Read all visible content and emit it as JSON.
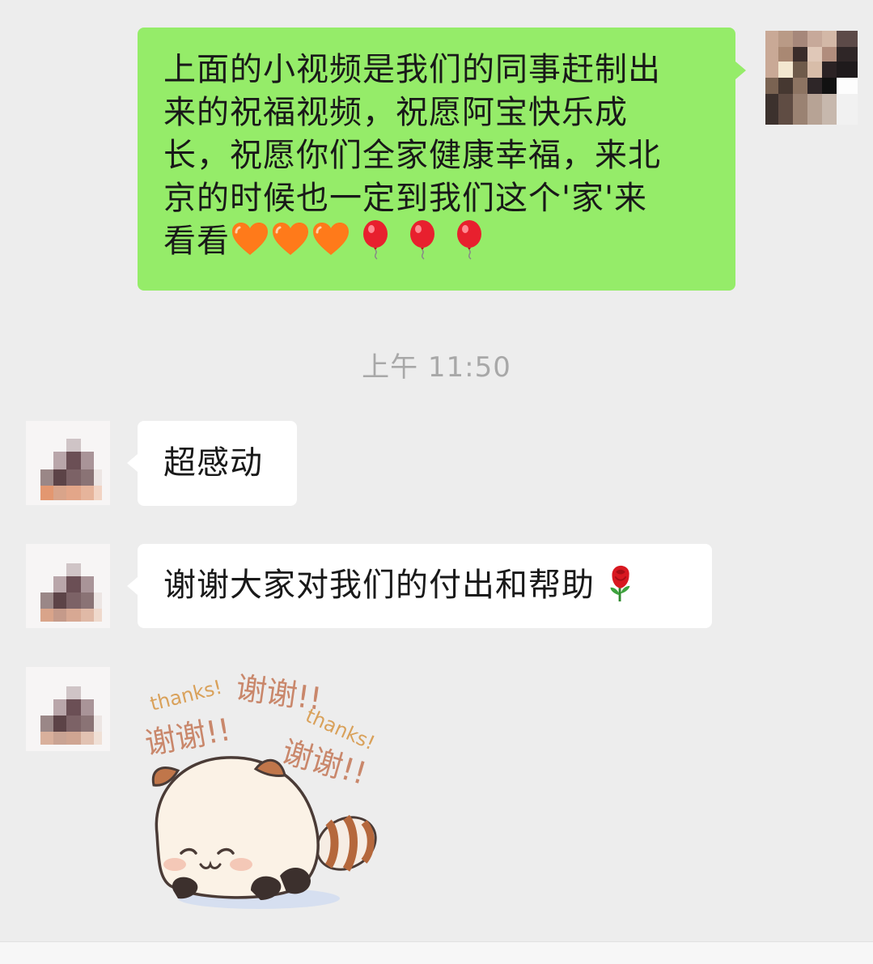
{
  "chat": {
    "messages": [
      {
        "direction": "outgoing",
        "lines": [
          "上面的小视频是我们的同事赶制出",
          "来的祝福视频，祝愿阿宝快乐成",
          "长，祝愿你们全家健康幸福，来北",
          "京的时候也一定到我们这个'家'来",
          "看看"
        ],
        "trailing_emojis": [
          "orange-heart-icon",
          "orange-heart-icon",
          "orange-heart-icon",
          "balloon-icon",
          "balloon-icon",
          "balloon-icon"
        ]
      },
      {
        "direction": "incoming",
        "text": "超感动"
      },
      {
        "direction": "incoming",
        "text": "谢谢大家对我们的付出和帮助",
        "trailing_emojis": [
          "rose-icon"
        ]
      },
      {
        "direction": "incoming",
        "type": "sticker",
        "sticker_texts": [
          "thanks!",
          "谢谢!!",
          "谢谢!!",
          "thanks!",
          "谢谢!!"
        ],
        "sticker_subject": "raccoon-panda-bowing"
      }
    ],
    "timestamp": "上午 11:50"
  },
  "colors": {
    "background": "#ededed",
    "outgoing_bubble": "#95ec69",
    "incoming_bubble": "#ffffff",
    "timestamp_text": "#a8a8a8",
    "sticker_text": "#c89067"
  }
}
